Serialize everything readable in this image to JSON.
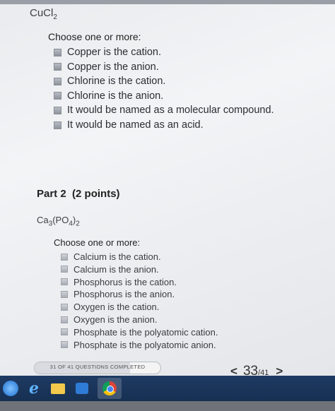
{
  "part1": {
    "formula_main": "CuCl",
    "formula_sub": "2",
    "prompt": "Choose one or more:",
    "options": [
      "Copper is the cation.",
      "Copper is the anion.",
      "Chlorine is the cation.",
      "Chlorine is the anion.",
      "It would be named as a molecular compound.",
      "It would be named as an acid."
    ]
  },
  "part2": {
    "title": "Part 2",
    "points": "(2 points)",
    "formula": {
      "a": "Ca",
      "a_sub": "3",
      "b": "(PO",
      "b_sub": "4",
      "c": ")",
      "c_sub": "2"
    },
    "prompt": "Choose one or more:",
    "options": [
      "Calcium is the cation.",
      "Calcium is the anion.",
      "Phosphorus is the cation.",
      "Phosphorus is the anion.",
      "Oxygen is the cation.",
      "Oxygen is the anion.",
      "Phosphate is the polyatomic cation.",
      "Phosphate is the polyatomic anion."
    ]
  },
  "footer": {
    "progress_text": "31 OF 41 QUESTIONS COMPLETED",
    "progress_fraction": 0.756,
    "prev": "<",
    "current": "33",
    "total": "/41",
    "next": ">"
  },
  "taskbar": {
    "icons": [
      "windows-start-icon",
      "internet-explorer-icon",
      "file-explorer-icon",
      "media-player-icon",
      "chrome-icon"
    ],
    "ie_glyph": "e"
  }
}
